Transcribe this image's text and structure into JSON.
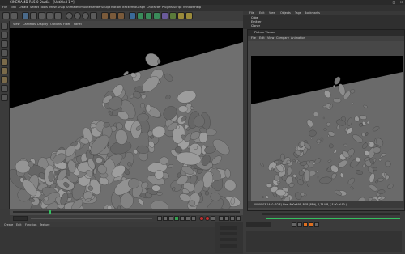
{
  "app": {
    "title": "CINEMA 4D R15.0 Studio - [Untitled 1 *]",
    "window_controls": [
      "–",
      "□",
      "✕"
    ]
  },
  "menu": [
    "File",
    "Edit",
    "Create",
    "Select",
    "Tools",
    "Mesh",
    "Snap",
    "Animate",
    "Simulate",
    "Render",
    "Sculpt",
    "Motion Tracker",
    "MoGraph",
    "Character",
    "Plugins",
    "Script",
    "Window",
    "Help"
  ],
  "viewport": {
    "menu": [
      "View",
      "Cameras",
      "Display",
      "Options",
      "Filter",
      "Panel"
    ]
  },
  "object_manager": {
    "menu": [
      "File",
      "Edit",
      "View",
      "Objects",
      "Tags",
      "Bookmarks"
    ],
    "objects": [
      "Cube",
      "Emitter",
      "Cloner"
    ]
  },
  "picture_viewer": {
    "title": "Picture Viewer",
    "menu": [
      "File",
      "Edit",
      "View",
      "Compare",
      "Animation"
    ],
    "status": "00:00:03  1440 (52 F)  Size: 800x495, RGB (8Bit), 1,74 MB,  ( F 90 of 90 )"
  },
  "materials": {
    "menu": [
      "Create",
      "Edit",
      "Function",
      "Texture"
    ]
  },
  "attributes": {
    "apply_label": "Apply"
  },
  "colors": {
    "scene_bg": "#000000",
    "floor": "#6f6f6f",
    "objects": "#8c8c8c",
    "timeline_marker": "#35c060",
    "play_accent": "#e07020"
  }
}
